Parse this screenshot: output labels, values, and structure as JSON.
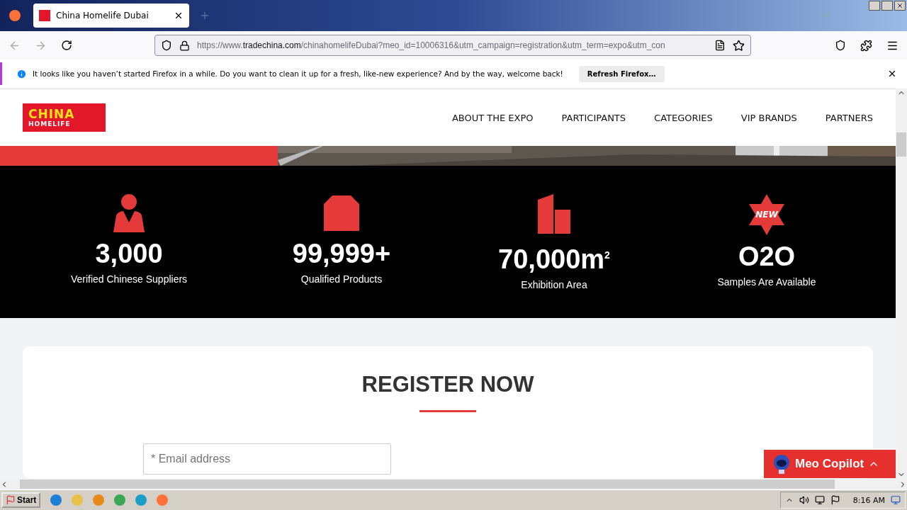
{
  "browser": {
    "tabs": [
      {
        "title": "China Homelife Dubai",
        "selected": true
      }
    ],
    "url": {
      "prefix": "https://www.",
      "domain": "tradechina.com",
      "rest": "/chinahomelifeDubai?meo_id=10006316&utm_campaign=registration&utm_term=expo&utm_con"
    },
    "notification": {
      "message": "It looks like you haven’t started Firefox in a while. Do you want to clean it up for a fresh, like-new experience? And by the way, welcome back!",
      "button": "Refresh Firefox…"
    }
  },
  "page": {
    "logo": {
      "line1": "CHINA",
      "line2": "HOMELIFE"
    },
    "nav": [
      {
        "label": "ABOUT THE EXPO"
      },
      {
        "label": "PARTICIPANTS"
      },
      {
        "label": "CATEGORIES"
      },
      {
        "label": "VIP BRANDS"
      },
      {
        "label": "PARTNERS"
      }
    ],
    "stats": [
      {
        "kind": "person",
        "value": "3,000",
        "label": "Verified Chinese Suppliers"
      },
      {
        "kind": "box",
        "value": "99,999+",
        "label": "Qualified Products"
      },
      {
        "kind": "building",
        "value": "70,000m$^{2}$",
        "label": "Exhibition Area"
      },
      {
        "kind": "new",
        "badge": "NEW",
        "value": "O2O",
        "label": "Samples Are Available"
      }
    ],
    "register": {
      "title": "REGISTER NOW",
      "email": {
        "placeholder": "* Email address"
      }
    },
    "copilot": {
      "label": "Meo Copilot"
    }
  },
  "taskbar": {
    "start": "Start",
    "clock": "8:16 AM"
  }
}
